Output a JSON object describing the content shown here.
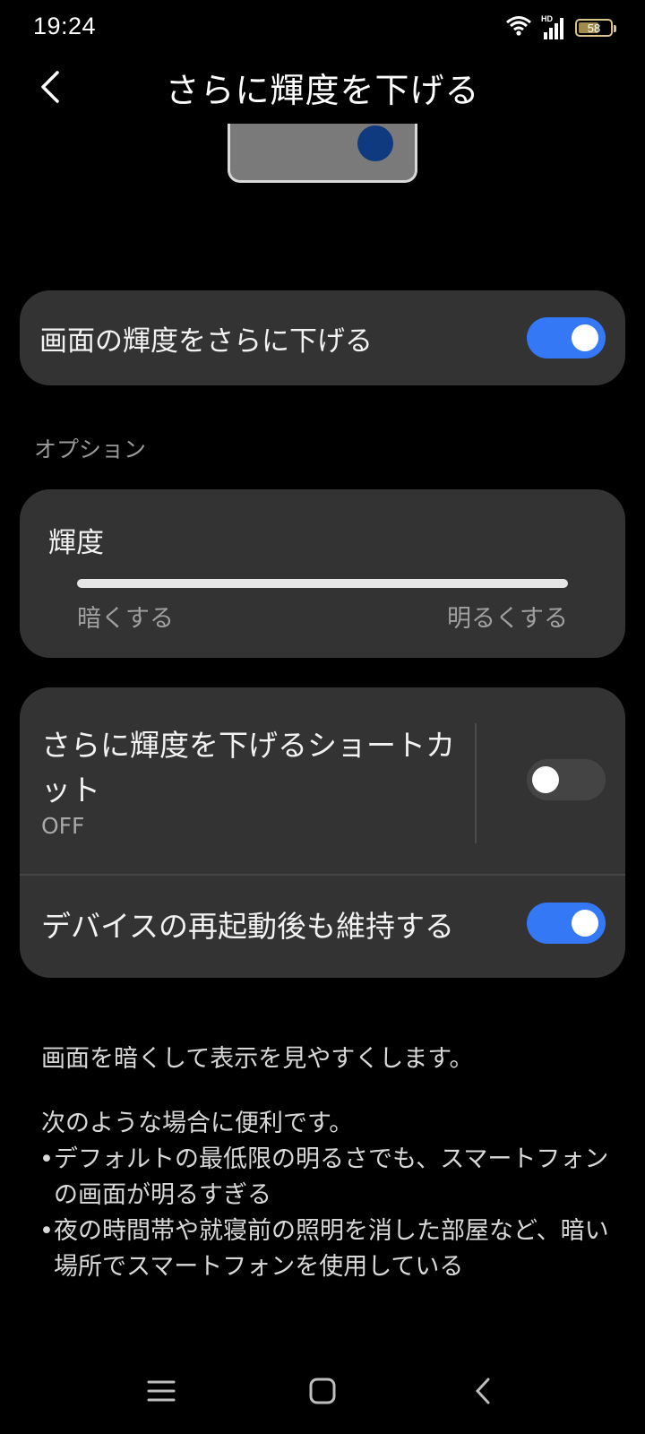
{
  "status_bar": {
    "time": "19:24",
    "network_badge": "HD",
    "battery_level": "58",
    "icons": [
      "wifi-icon",
      "signal-icon",
      "battery-icon"
    ]
  },
  "header": {
    "title": "さらに輝度を下げる",
    "back_icon": "back-chevron-icon"
  },
  "main_toggle": {
    "label": "画面の輝度をさらに下げる",
    "enabled": true
  },
  "options": {
    "section_label": "オプション",
    "brightness": {
      "title": "輝度",
      "min_label": "暗くする",
      "max_label": "明るくする"
    },
    "shortcut": {
      "label": "さらに輝度を下げるショートカット",
      "status": "OFF",
      "enabled": false
    },
    "keep_after_restart": {
      "label": "デバイスの再起動後も維持する",
      "enabled": true
    }
  },
  "description": {
    "intro": "画面を暗くして表示を見やすくします。",
    "useful_heading": "次のような場合に便利です。",
    "bullets": [
      "デフォルトの最低限の明るさでも、スマートフォンの画面が明るすぎる",
      "夜の時間帯や就寝前の照明を消した部屋など、暗い場所でスマートフォンを使用している"
    ]
  },
  "nav_bar": {
    "icons": [
      "recent-apps-icon",
      "home-icon",
      "back-icon"
    ]
  },
  "colors": {
    "accent": "#3478f6",
    "card_bg": "#333333",
    "background": "#000000"
  }
}
